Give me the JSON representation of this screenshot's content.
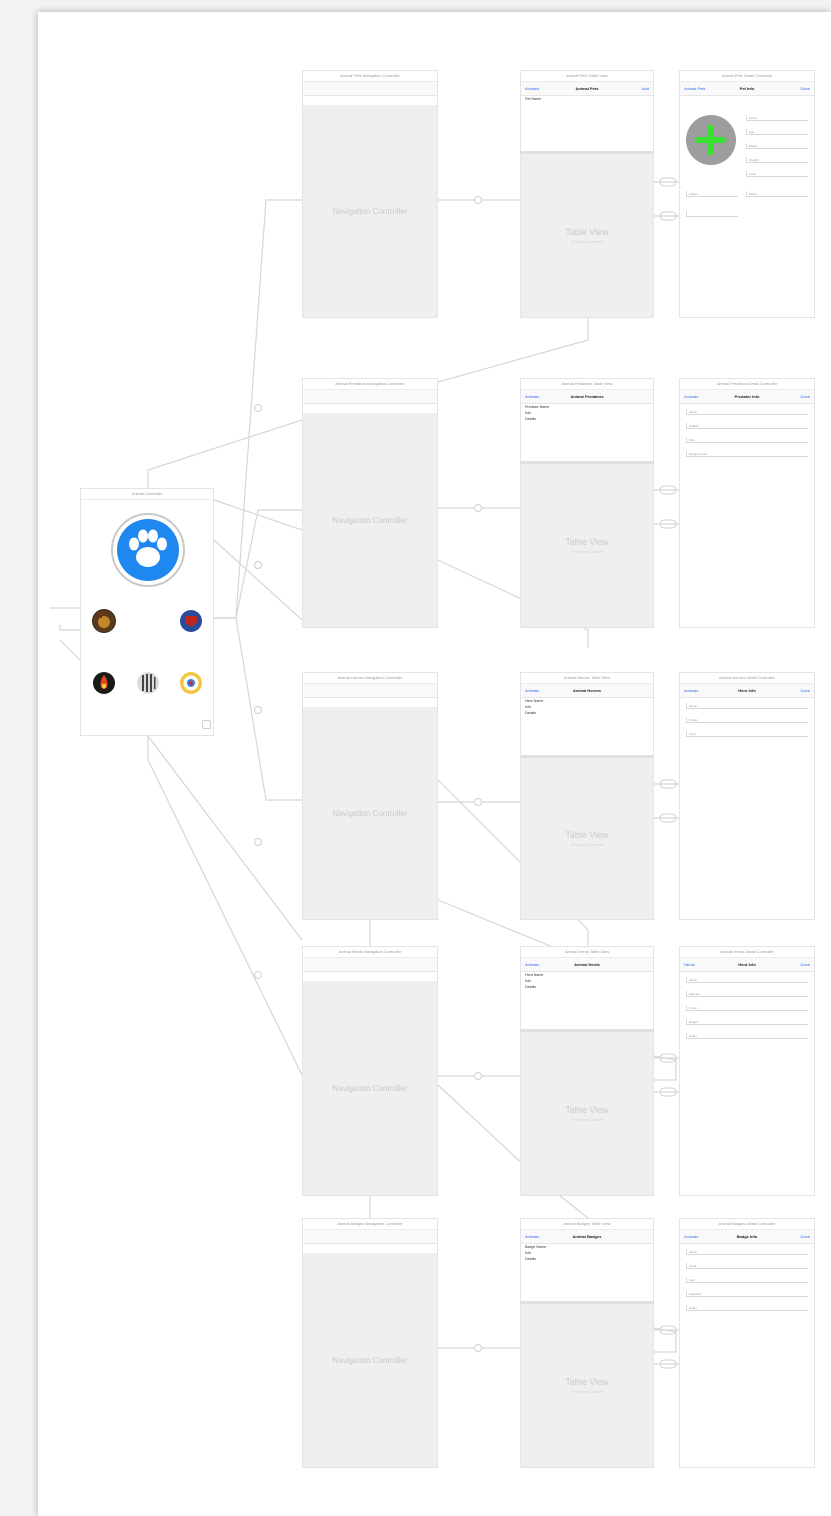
{
  "storyboard": {
    "colors": {
      "canvas": "#ffffff",
      "scene_bg": "#efefef",
      "connector": "#d6d6d6",
      "link": "#2d6cf0",
      "paw": "#1e88f0",
      "add": "#39e033"
    },
    "nav_placeholder": "Navigation Controller",
    "table_placeholder": "Table View",
    "prototype_placeholder": "Prototype Content",
    "initial_scene": {
      "title": "Animal Controller",
      "icons": [
        "paw-icon",
        "lion-avatar-icon",
        "shield-avatar-icon",
        "fire-avatar-icon",
        "zebra-avatar-icon",
        "badge-avatar-icon"
      ]
    },
    "rows": [
      {
        "nav_title": "Animal Pets Navigation Controller",
        "table_title": "Animal Pets Table View",
        "table_nav": {
          "left": "Animals",
          "mid": "Animal Pets",
          "right": "Add"
        },
        "table_lines": [
          "Pet Name"
        ],
        "detail_title": "Animal Pets Detail Controller",
        "detail_nav": {
          "left": "Animal Pets",
          "mid": "Pet Info",
          "right": "Done"
        },
        "detail_icon": "add-photo-icon",
        "detail_fields": [
          "Name",
          "Age",
          "Breed",
          "Weight",
          "Color",
          "Owner",
          "Notes"
        ]
      },
      {
        "nav_title": "Animal Predators Navigation Controller",
        "table_title": "Animal Predators Table View",
        "table_nav": {
          "left": "Animals",
          "mid": "Animal Predators",
          "right": ""
        },
        "table_lines": [
          "Predator Name",
          "Info",
          "Details"
        ],
        "detail_title": "Animal Predators Detail Controller",
        "detail_nav": {
          "left": "Animals",
          "mid": "Predator Info",
          "right": "Done"
        },
        "detail_fields": [
          "Name",
          "Habitat",
          "Diet",
          "Danger Level"
        ]
      },
      {
        "nav_title": "Animal Heroes Navigation Controller",
        "table_title": "Animal Heroes Table View",
        "table_nav": {
          "left": "Animals",
          "mid": "Animal Heroes",
          "right": ""
        },
        "table_lines": [
          "Hero Name",
          "Info",
          "Details"
        ],
        "detail_title": "Animal Heroes Detail Controller",
        "detail_nav": {
          "left": "Animals",
          "mid": "Hero Info",
          "right": "Done"
        },
        "detail_fields": [
          "Name",
          "Power",
          "Story"
        ]
      },
      {
        "nav_title": "Animal Herds Navigation Controller",
        "table_title": "Animal Herds Table View",
        "table_nav": {
          "left": "Animals",
          "mid": "Animal Herds",
          "right": ""
        },
        "table_lines": [
          "Herd Name",
          "Info",
          "Details"
        ],
        "detail_title": "Animal Herds Detail Controller",
        "detail_nav": {
          "left": "Herds",
          "mid": "Herd Info",
          "right": "Done"
        },
        "detail_fields": [
          "Name",
          "Species",
          "Count",
          "Region",
          "Notes"
        ]
      },
      {
        "nav_title": "Animal Badges Navigation Controller",
        "table_title": "Animal Badges Table View",
        "table_nav": {
          "left": "Animals",
          "mid": "Animal Badges",
          "right": ""
        },
        "table_lines": [
          "Badge Name",
          "Info",
          "Details"
        ],
        "detail_title": "Animal Badges Detail Controller",
        "detail_nav": {
          "left": "Animals",
          "mid": "Badge Info",
          "right": "Done"
        },
        "detail_fields": [
          "Name",
          "Level",
          "Year",
          "Awarded",
          "Notes"
        ]
      }
    ]
  }
}
